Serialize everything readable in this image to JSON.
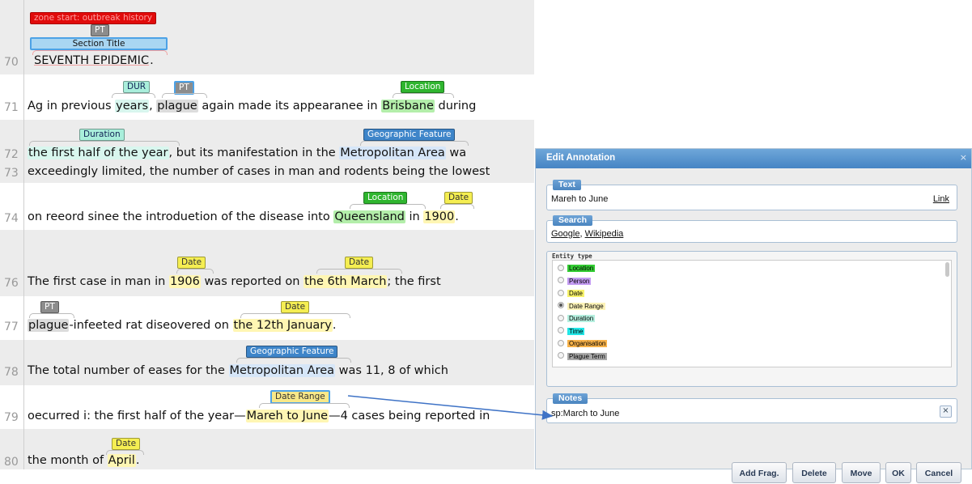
{
  "document": {
    "zone_label": "zone start: outbreak history",
    "lines": [
      {
        "num": "70",
        "segments": [
          {
            "t": "SEVENTH EPIDEMIC",
            "c": "hl-title"
          },
          {
            "t": "."
          }
        ]
      },
      {
        "num": "71",
        "segments": [
          {
            "t": "Ag in previous "
          },
          {
            "t": "years",
            "c": "hl-dur"
          },
          {
            "t": ", "
          },
          {
            "t": "plague",
            "c": "hl-pt"
          },
          {
            "t": " again made its appearanee in "
          },
          {
            "t": "Brisbane",
            "c": "hl-loc"
          },
          {
            "t": " during"
          }
        ]
      },
      {
        "num": "72",
        "segments": [
          {
            "t": "the first half of the year",
            "c": "hl-dur"
          },
          {
            "t": ", but its manifestation in the "
          },
          {
            "t": "Metropolitan Area",
            "c": "hl-geo"
          },
          {
            "t": " wa"
          }
        ]
      },
      {
        "num": "73",
        "segments": [
          {
            "t": "exceedingly limited, the number of cases in man and rodents being the lowest"
          }
        ]
      },
      {
        "num": "74",
        "segments": [
          {
            "t": "on reeord sinee the introduetion of the disease into "
          },
          {
            "t": "Queensland",
            "c": "hl-loc"
          },
          {
            "t": " in "
          },
          {
            "t": "1900",
            "c": "hl-date"
          },
          {
            "t": "."
          }
        ]
      },
      {
        "num": "76",
        "segments": [
          {
            "t": "The first case in man in "
          },
          {
            "t": "1906",
            "c": "hl-date"
          },
          {
            "t": " was reported on "
          },
          {
            "t": "the 6th March",
            "c": "hl-date"
          },
          {
            "t": "; the first"
          }
        ]
      },
      {
        "num": "77",
        "segments": [
          {
            "t": "plague",
            "c": "hl-pt"
          },
          {
            "t": "-infeeted rat diseovered on "
          },
          {
            "t": "the 12th January",
            "c": "hl-date"
          },
          {
            "t": "."
          }
        ]
      },
      {
        "num": "78",
        "segments": [
          {
            "t": "The total number of eases for the "
          },
          {
            "t": "Metropolitan Area",
            "c": "hl-geo"
          },
          {
            "t": " was 11, 8 of which"
          }
        ]
      },
      {
        "num": "79",
        "segments": [
          {
            "t": "oecurred i: the first half of the year—"
          },
          {
            "t": "Mareh to June",
            "c": "hl-date"
          },
          {
            "t": "—4 cases being reported in"
          }
        ]
      },
      {
        "num": "80",
        "segments": [
          {
            "t": "the month of "
          },
          {
            "t": "April",
            "c": "hl-date"
          },
          {
            "t": "."
          }
        ]
      }
    ],
    "tags": [
      {
        "label": "PT",
        "type": "pt"
      },
      {
        "label": "Section Title",
        "type": "title"
      },
      {
        "label": "DUR",
        "type": "dur"
      },
      {
        "label": "PT",
        "type": "pt"
      },
      {
        "label": "Location",
        "type": "loc"
      },
      {
        "label": "Duration",
        "type": "dur"
      },
      {
        "label": "Geographic Feature",
        "type": "geo"
      },
      {
        "label": "Location",
        "type": "loc"
      },
      {
        "label": "Date",
        "type": "date"
      },
      {
        "label": "Date",
        "type": "date"
      },
      {
        "label": "Date",
        "type": "date"
      },
      {
        "label": "PT",
        "type": "pt"
      },
      {
        "label": "Date",
        "type": "date"
      },
      {
        "label": "Geographic Feature",
        "type": "geo"
      },
      {
        "label": "Date Range",
        "type": "range"
      },
      {
        "label": "Date",
        "type": "date"
      }
    ]
  },
  "dialog": {
    "title": "Edit Annotation",
    "close": "×",
    "text_label": "Text",
    "text_value": "Mareh to June",
    "link_label": "Link",
    "search_label": "Search",
    "search_google": "Google",
    "search_sep": ", ",
    "search_wikipedia": "Wikipedia",
    "entity_type_label": "Entity type",
    "entity_types": [
      {
        "name": "Location",
        "color": "#33cc33",
        "selected": false
      },
      {
        "name": "Person",
        "color": "#c39bf2",
        "selected": false
      },
      {
        "name": "Date",
        "color": "#f7f26a",
        "selected": false
      },
      {
        "name": "Date Range",
        "color": "#fdf3b8",
        "selected": true
      },
      {
        "name": "Duration",
        "color": "#b5efdf",
        "selected": false
      },
      {
        "name": "Time",
        "color": "#22e6e6",
        "selected": false
      },
      {
        "name": "Organisation",
        "color": "#f7b24a",
        "selected": false
      },
      {
        "name": "Plague Term",
        "color": "#a8a8a8",
        "selected": false
      }
    ],
    "notes_label": "Notes",
    "notes_value": "sp:March to June",
    "notes_clear": "×",
    "buttons": {
      "add_frag": "Add Frag.",
      "delete": "Delete",
      "move": "Move",
      "ok": "OK",
      "cancel": "Cancel"
    }
  },
  "colors": {
    "loc_tag": "#2fb52f",
    "date_tag": "#f5ee52",
    "dur_tag": "#a9eedb",
    "geo_tag": "#3e85c9",
    "pt_tag": "#8c8c8c",
    "title_tag": "#a9d6f2",
    "zone_tag": "#e10b0b",
    "range_tag": "#f8e888",
    "dialog_header": "#4f8ccb",
    "arrow": "#3f73c6"
  }
}
